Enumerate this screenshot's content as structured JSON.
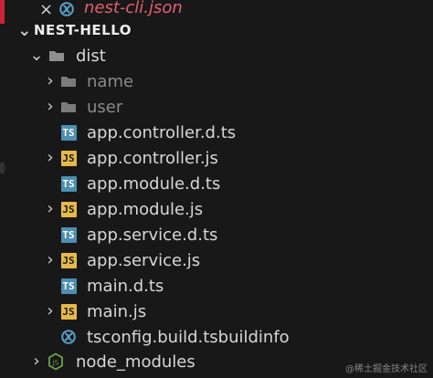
{
  "openEditors": {
    "file": "nest-cli.json"
  },
  "project": {
    "title": "NEST-HELLO"
  },
  "tree": {
    "dist": "dist",
    "items": [
      {
        "name": "name",
        "type": "folder"
      },
      {
        "name": "user",
        "type": "folder"
      },
      {
        "name": "app.controller.d.ts",
        "type": "ts"
      },
      {
        "name": "app.controller.js",
        "type": "js"
      },
      {
        "name": "app.module.d.ts",
        "type": "ts"
      },
      {
        "name": "app.module.js",
        "type": "js"
      },
      {
        "name": "app.service.d.ts",
        "type": "ts"
      },
      {
        "name": "app.service.js",
        "type": "js"
      },
      {
        "name": "main.d.ts",
        "type": "ts"
      },
      {
        "name": "main.js",
        "type": "js"
      },
      {
        "name": "tsconfig.build.tsbuildinfo",
        "type": "json"
      }
    ],
    "node_modules": "node_modules"
  },
  "watermark": "@稀土掘金技术社区",
  "colors": {
    "background": "#181818",
    "ts_badge": "#4c8fb1",
    "js_badge": "#e5b94a",
    "folder": "#8f8f8f",
    "json_icon": "#5aa0c8",
    "error_accent": "#c8253b",
    "italic_json": "#e2606c"
  },
  "badges": {
    "ts": "TS",
    "js": "JS"
  }
}
